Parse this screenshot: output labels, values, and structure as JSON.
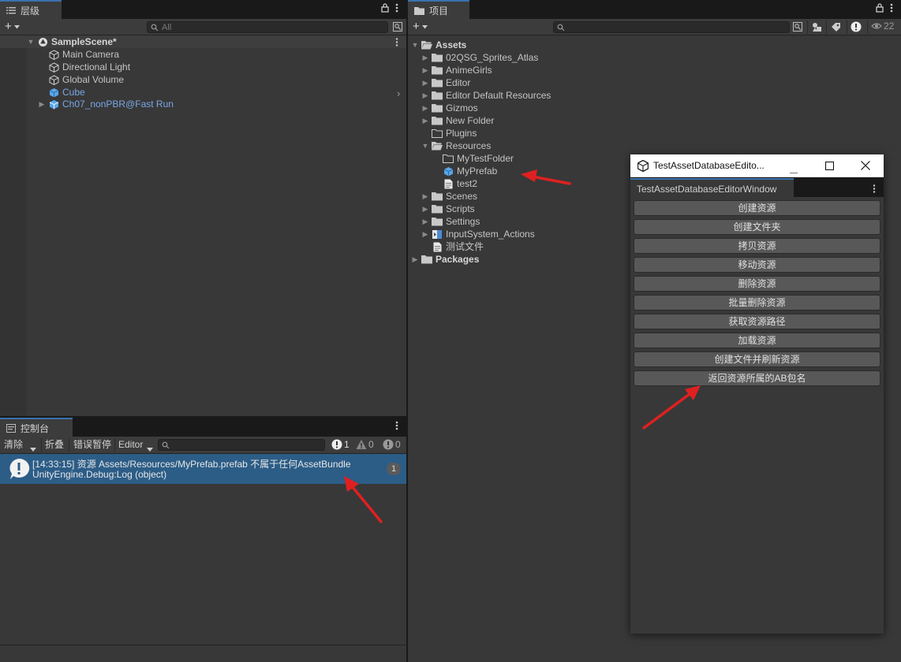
{
  "hierarchy": {
    "tab_label": "层级",
    "search_placeholder": "All",
    "scene": "SampleScene*",
    "items": [
      "Main Camera",
      "Directional Light",
      "Global Volume",
      "Cube",
      "Ch07_nonPBR@Fast Run"
    ]
  },
  "project": {
    "tab_label": "项目",
    "visible_count": "22",
    "assets_label": "Assets",
    "folders": [
      "02QSG_Sprites_Atlas",
      "AnimeGirls",
      "Editor",
      "Editor Default Resources",
      "Gizmos",
      "New Folder",
      "Plugins",
      "Resources"
    ],
    "resources_children": [
      "MyTestFolder",
      "MyPrefab",
      "test2"
    ],
    "folders_after": [
      "Scenes",
      "Scripts",
      "Settings",
      "InputSystem_Actions",
      "测试文件"
    ],
    "packages_label": "Packages"
  },
  "console": {
    "tab_label": "控制台",
    "clear_label": "清除",
    "collapse_label": "折叠",
    "error_pause_label": "错误暂停",
    "editor_label": "Editor",
    "info_count": "1",
    "warn_count": "0",
    "error_count": "0",
    "log_line1": "[14:33:15] 资源 Assets/Resources/MyPrefab.prefab 不属于任何AssetBundle",
    "log_line2": "UnityEngine.Debug:Log (object)",
    "log_count": "1"
  },
  "editor_window": {
    "title": "TestAssetDatabaseEdito...",
    "tab_label": "TestAssetDatabaseEditorWindow",
    "buttons": [
      "创建资源",
      "创建文件夹",
      "拷贝资源",
      "移动资源",
      "删除资源",
      "批量删除资源",
      "获取资源路径",
      "加载资源",
      "创建文件并刷新资源",
      "返回资源所属的AB包名"
    ]
  },
  "colors": {
    "selection": "#2c5d87",
    "accent_blue": "#7aa7e6",
    "annotation_arrow": "#e02020"
  }
}
